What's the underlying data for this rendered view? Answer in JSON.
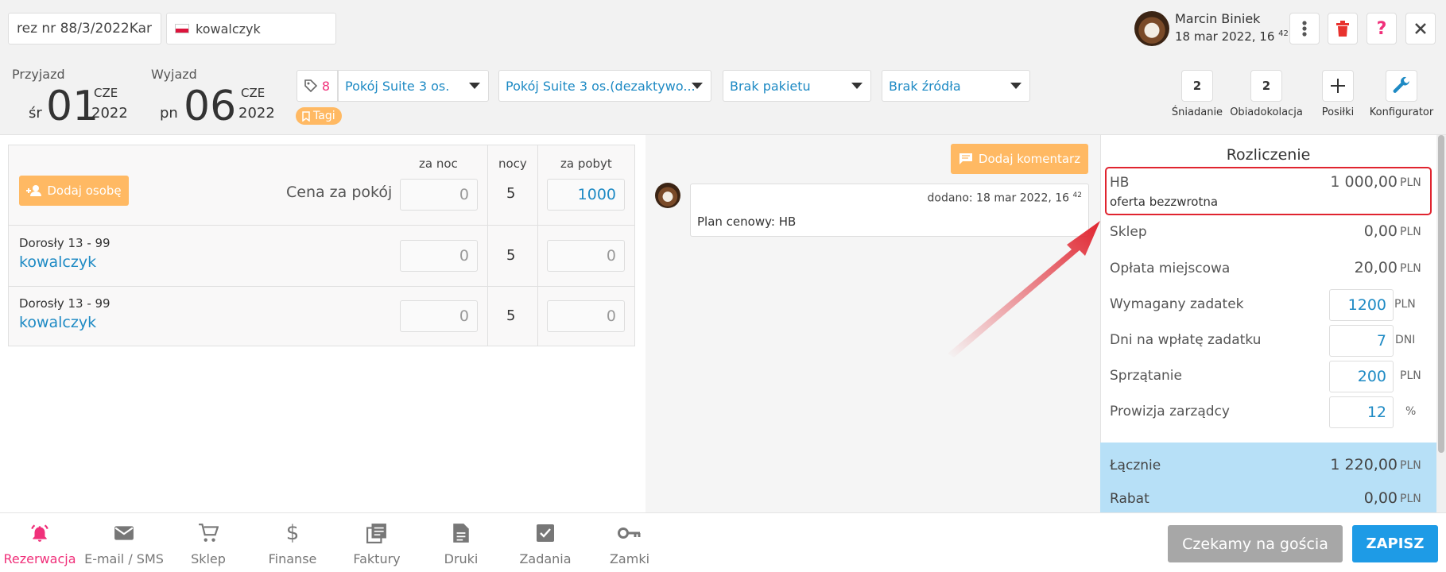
{
  "header": {
    "reservation_field": "rez nr 88/3/2022Kar",
    "guest_field": "kowalczyk",
    "user_name": "Marcin Biniek",
    "user_date": "18 mar 2022, 16",
    "user_date_sup": "42"
  },
  "dates": {
    "arrival_label": "Przyjazd",
    "arrival_weekday": "śr",
    "arrival_day": "01",
    "arrival_month": "CZE",
    "arrival_year": "2022",
    "departure_label": "Wyjazd",
    "departure_weekday": "pn",
    "departure_day": "06",
    "departure_month": "CZE",
    "departure_year": "2022"
  },
  "room": {
    "tag_count": "8",
    "room_select": "Pokój Suite 3 os.",
    "room_type_select": "Pokój Suite 3 os.(dezaktywo...",
    "package_select": "Brak pakietu",
    "source_select": "Brak źródła",
    "tags_button": "Tagi"
  },
  "meals": {
    "breakfast_count": "2",
    "breakfast_label": "Śniadanie",
    "dinner_count": "2",
    "dinner_label": "Obiadokolacja",
    "meals_label": "Posiłki",
    "configurator_label": "Konfigurator"
  },
  "persons": {
    "add_person_button": "Dodaj osobę",
    "col_per_night": "za noc",
    "col_nights": "nocy",
    "col_per_stay": "za pobyt",
    "room_price_label": "Cena za pokój",
    "room_per_night": "0",
    "room_nights": "5",
    "room_per_stay": "1000",
    "rows": [
      {
        "category": "Dorosły 13 - 99",
        "name": "kowalczyk",
        "per_night": "0",
        "nights": "5",
        "per_stay": "0"
      },
      {
        "category": "Dorosły 13 - 99",
        "name": "kowalczyk",
        "per_night": "0",
        "nights": "5",
        "per_stay": "0"
      }
    ]
  },
  "comments": {
    "add_comment_button": "Dodaj komentarz",
    "comment_meta": "dodano: 18 mar 2022, 16",
    "comment_meta_sup": "42",
    "comment_text": "Plan cenowy: HB"
  },
  "settlement": {
    "title": "Rozliczenie",
    "plan_name": "HB",
    "plan_value": "1 000,00",
    "plan_note": "oferta bezzwrotna",
    "currency": "PLN",
    "shop_label": "Sklep",
    "shop_value": "0,00",
    "local_fee_label": "Opłata miejscowa",
    "local_fee_value": "20,00",
    "deposit_label": "Wymagany zadatek",
    "deposit_value": "1200",
    "deposit_days_label": "Dni na wpłatę zadatku",
    "deposit_days_value": "7",
    "days_unit": "DNI",
    "cleaning_label": "Sprzątanie",
    "cleaning_value": "200",
    "commission_label": "Prowizja zarządcy",
    "commission_value": "12",
    "percent_unit": "%",
    "total_label": "Łącznie",
    "total_value": "1 220,00",
    "discount_label": "Rabat",
    "discount_value": "0,00"
  },
  "nav": {
    "items": [
      "Rezerwacja",
      "E-mail / SMS",
      "Sklep",
      "Finanse",
      "Faktury",
      "Druki",
      "Zadania",
      "Zamki"
    ]
  },
  "actions": {
    "status_button": "Czekamy na gościa",
    "save_button": "ZAPISZ"
  },
  "colors": {
    "accent_blue": "#1e8ac4",
    "orange": "#ffb963",
    "active_pink": "#f0307a",
    "highlight_red": "#e0242f",
    "total_bg": "#b7e0f7"
  }
}
